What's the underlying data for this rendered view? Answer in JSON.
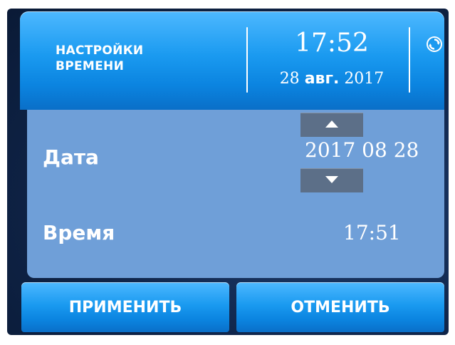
{
  "header": {
    "title_line1": "НАСТРОЙКИ",
    "title_line2": "ВРЕМЕНИ",
    "clock_time": "17:52",
    "clock_day": "28",
    "clock_month": "авг.",
    "clock_year": "2017",
    "sync_icon": "refresh-icon"
  },
  "form": {
    "date_label": "Дата",
    "date_year": "2017",
    "date_month": "08",
    "date_day": "28",
    "time_label": "Время",
    "time_value": "17:51"
  },
  "buttons": {
    "apply": "ПРИМЕНИТЬ",
    "cancel": "ОТМЕНИТЬ"
  },
  "colors": {
    "header_blue": "#1a9af0",
    "panel_blue": "#6f9fd8",
    "stepper_gray": "#5c6f88",
    "background_navy": "#0f2448"
  }
}
